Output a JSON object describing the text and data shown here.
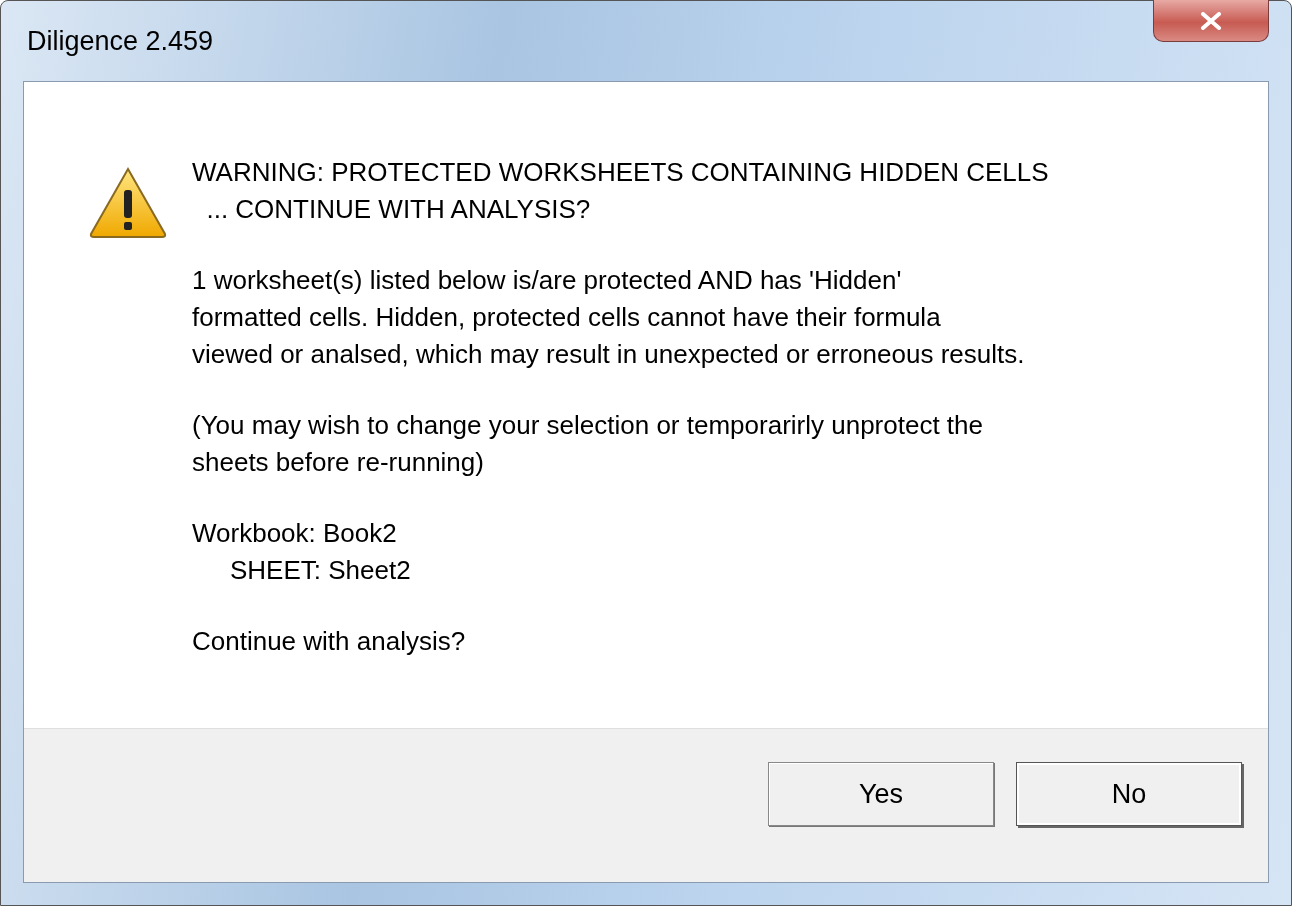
{
  "window": {
    "title": "Diligence 2.459"
  },
  "message": {
    "heading": [
      "WARNING: PROTECTED WORKSHEETS CONTAINING HIDDEN CELLS",
      "  ... CONTINUE WITH ANALYSIS?"
    ],
    "paragraphs": [
      [
        "1 worksheet(s) listed below is/are protected AND has 'Hidden'",
        "formatted cells. Hidden, protected cells cannot have their formula",
        "viewed or analsed, which may result in unexpected or erroneous results."
      ],
      [
        "(You may wish to change your selection or temporarirly unprotect the",
        "sheets before re-running)"
      ]
    ],
    "workbooks": [
      {
        "label": "Workbook: Book2",
        "children": [
          {
            "label": "SHEET: Sheet2"
          }
        ]
      }
    ],
    "question": "Continue with analysis?"
  },
  "buttons": [
    {
      "label": "Yes",
      "default": false
    },
    {
      "label": "No",
      "default": true
    }
  ]
}
